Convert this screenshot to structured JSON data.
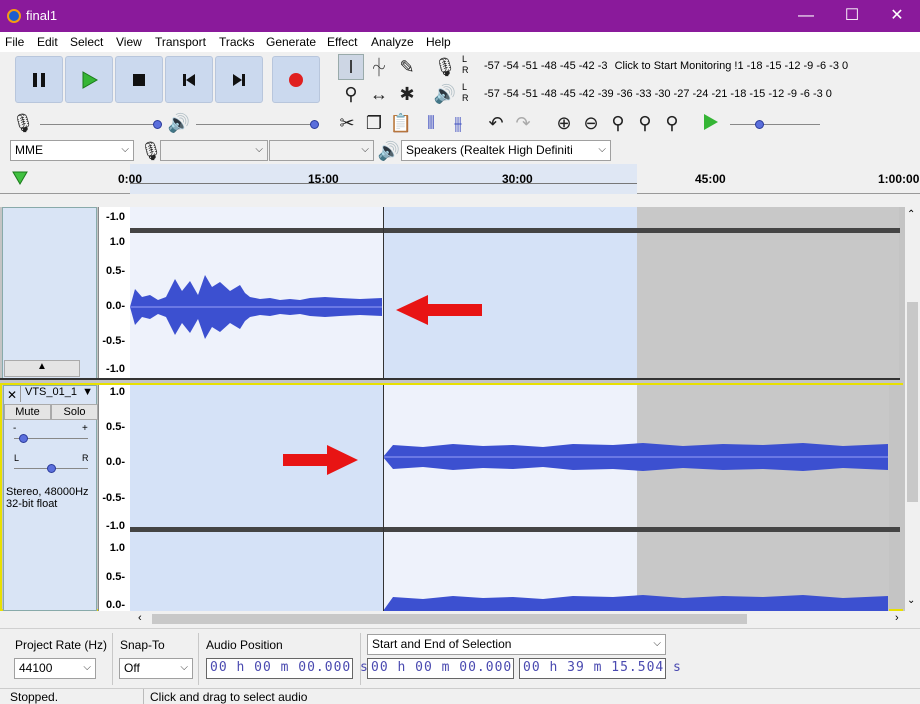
{
  "window": {
    "title": "final1",
    "minimize": "—",
    "maximize": "☐",
    "close": "✕"
  },
  "menu": [
    "File",
    "Edit",
    "Select",
    "View",
    "Transport",
    "Tracks",
    "Generate",
    "Effect",
    "Analyze",
    "Help"
  ],
  "meters": {
    "record_scale": "-57 -54 -51 -48 -45 -42 -3",
    "record_prompt": "Click to Start Monitoring",
    "record_scale_tail": "!1 -18 -15 -12  -9  -6  -3  0",
    "play_scale": "-57 -54 -51 -48 -45 -42 -39 -36 -33 -30 -27 -24 -21 -18 -15 -12  -9  -6  -3  0",
    "L": "L",
    "R": "R"
  },
  "device": {
    "host": "MME",
    "rec_device": "",
    "channels": "",
    "playback": "Speakers (Realtek High Definiti"
  },
  "ruler": {
    "marks": [
      "0:00",
      "15:00",
      "30:00",
      "45:00",
      "1:00:00"
    ]
  },
  "track1": {
    "scale_top": "-1.0",
    "scale": [
      "1.0",
      "0.5-",
      "0.0-",
      "-0.5-",
      "-1.0"
    ]
  },
  "track2": {
    "name": "VTS_01_1",
    "close": "✕",
    "mute": "Mute",
    "solo": "Solo",
    "gain_minus": "-",
    "gain_plus": "+",
    "pan_l": "L",
    "pan_r": "R",
    "info_line1": "Stereo, 48000Hz",
    "info_line2": "32-bit float",
    "scale": [
      "1.0",
      "0.5-",
      "0.0-",
      "-0.5-",
      "-1.0"
    ],
    "scale2": [
      "1.0",
      "0.5-",
      "0.0-"
    ]
  },
  "bottom": {
    "project_rate_label": "Project Rate (Hz)",
    "project_rate": "44100",
    "snap_label": "Snap-To",
    "snap_value": "Off",
    "audio_pos_label": "Audio Position",
    "audio_pos": "00 h 00 m 00.000 s",
    "selection_label": "Start and End of Selection",
    "sel_start": "00 h 00 m 00.000 s",
    "sel_end": "00 h 39 m 15.504 s"
  },
  "status": {
    "state": "Stopped.",
    "hint": "Click and drag to select audio"
  },
  "colors": {
    "titlebar": "#8a1a9b",
    "waveform": "#3c50d0",
    "arrow": "#e81414"
  }
}
